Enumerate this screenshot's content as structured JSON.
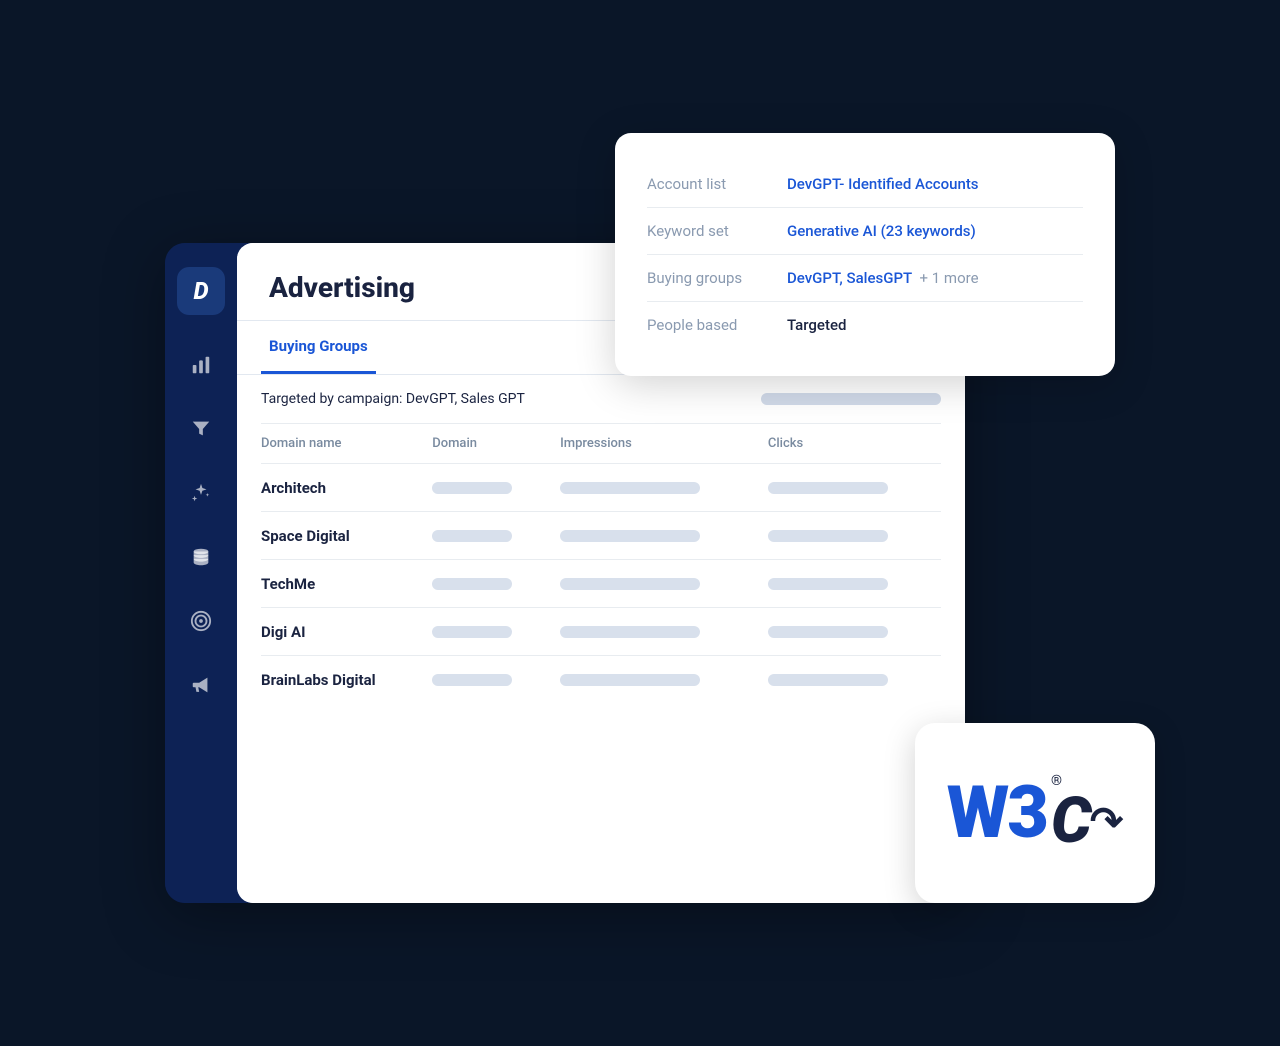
{
  "info_card": {
    "rows": [
      {
        "label": "Account list",
        "value": "DevGPT- Identified Accounts",
        "value_type": "blue",
        "extra": ""
      },
      {
        "label": "Keyword set",
        "value": "Generative AI (23 keywords)",
        "value_type": "blue",
        "extra": ""
      },
      {
        "label": "Buying groups",
        "value": "DevGPT, SalesGPT",
        "value_type": "blue",
        "extra": "+ 1 more"
      },
      {
        "label": "People based",
        "value": "Targeted",
        "value_type": "dark",
        "extra": ""
      }
    ]
  },
  "page": {
    "title": "Advertising"
  },
  "tab": {
    "label": "Buying Groups"
  },
  "campaign_filter": {
    "text": "Targeted by campaign: DevGPT, Sales GPT"
  },
  "table": {
    "columns": [
      "Domain name",
      "Domain",
      "Impressions",
      "Clicks"
    ],
    "rows": [
      {
        "name": "Architech"
      },
      {
        "name": "Space Digital"
      },
      {
        "name": "TechMe"
      },
      {
        "name": "Digi AI"
      },
      {
        "name": "BrainLabs Digital"
      }
    ]
  },
  "nav": {
    "items": [
      "chart-bar-icon",
      "funnel-icon",
      "magic-icon",
      "database-icon",
      "target-icon",
      "megaphone-icon"
    ]
  }
}
